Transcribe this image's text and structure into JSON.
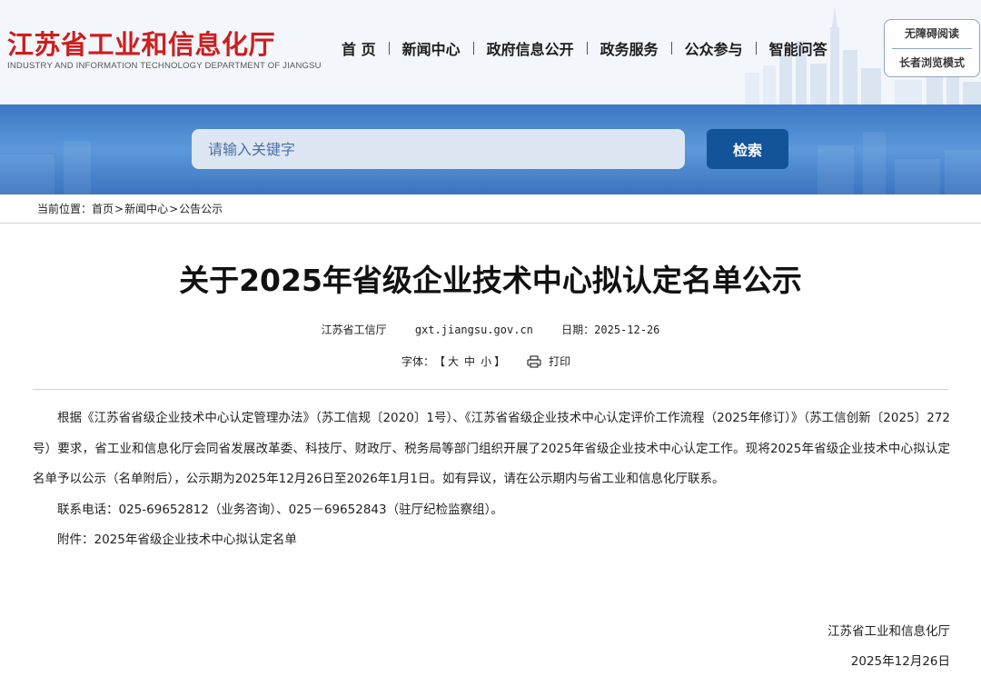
{
  "header": {
    "logo_cn": "江苏省工业和信息化厅",
    "logo_en": "INDUSTRY AND INFORMATION TECHNOLOGY DEPARTMENT OF JIANGSU",
    "nav": [
      "首 页",
      "新闻中心",
      "政府信息公开",
      "政务服务",
      "公众参与",
      "智能问答"
    ],
    "accessibility": {
      "barrier_free": "无障碍阅读",
      "elder_mode": "长者浏览模式"
    }
  },
  "search": {
    "placeholder": "请输入关键字",
    "button": "检索"
  },
  "breadcrumb": {
    "prefix": "当前位置：",
    "items": [
      "首页",
      "新闻中心",
      "公告公示"
    ],
    "separator": ">"
  },
  "article": {
    "title": "关于2025年省级企业技术中心拟认定名单公示",
    "source": "江苏省工信厅",
    "site": "gxt.jiangsu.gov.cn",
    "date_label": "日期：",
    "date": "2025-12-26",
    "font_label": "字体：",
    "font_open": "【",
    "font_sizes": [
      "大",
      "中",
      "小"
    ],
    "font_close": "】",
    "print_label": "打印",
    "paragraphs": [
      "根据《江苏省省级企业技术中心认定管理办法》（苏工信规〔2020〕1号）、《江苏省省级企业技术中心认定评价工作流程（2025年修订）》（苏工信创新〔2025〕272号）要求，省工业和信息化厅会同省发展改革委、科技厅、财政厅、税务局等部门组织开展了2025年省级企业技术中心认定工作。现将2025年省级企业技术中心拟认定名单予以公示（名单附后），公示期为2025年12月26日至2026年1月1日。如有异议，请在公示期内与省工业和信息化厅联系。",
      "联系电话：025-69652812（业务咨询）、025－69652843（驻厅纪检监察组）。",
      "附件：2025年省级企业技术中心拟认定名单"
    ],
    "signature": {
      "org": "江苏省工业和信息化厅",
      "date": "2025年12月26日"
    }
  },
  "colors": {
    "brand_red": "#cc1f1f",
    "band_blue": "#4a86d0",
    "button_blue": "#12539a"
  }
}
